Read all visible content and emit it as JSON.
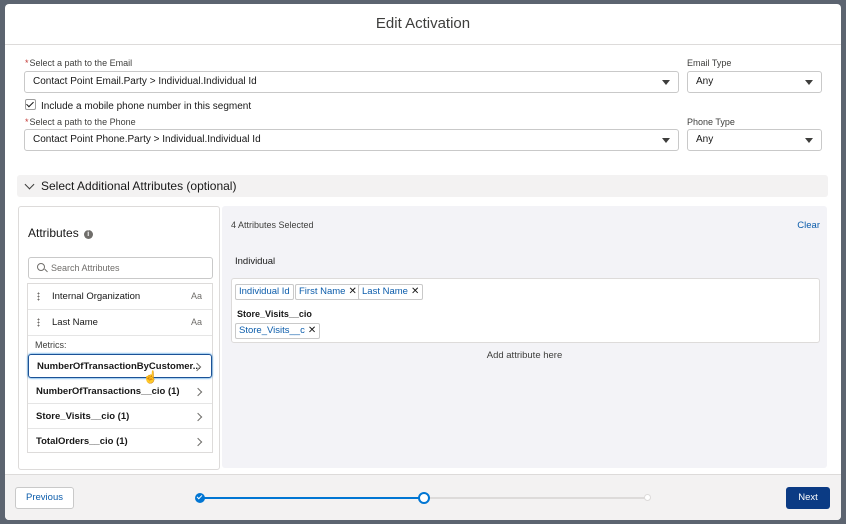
{
  "modal": {
    "title": "Edit Activation"
  },
  "email": {
    "path_label": "Select a path to the Email",
    "path_value": "Contact Point Email.Party > Individual.Individual Id",
    "type_label": "Email Type",
    "type_value": "Any"
  },
  "include_phone": {
    "label": "Include a mobile phone number in this segment",
    "checked": true
  },
  "phone": {
    "path_label": "Select a path to the Phone",
    "path_value": "Contact Point Phone.Party > Individual.Individual Id",
    "type_label": "Phone Type",
    "type_value": "Any"
  },
  "additional_section": {
    "label": "Select Additional Attributes (optional)"
  },
  "attributes_panel": {
    "title": "Attributes",
    "search_placeholder": "Search Attributes",
    "items": [
      {
        "label": "Internal Organization",
        "type_icon": "Aa"
      },
      {
        "label": "Last Name",
        "type_icon": "Aa"
      }
    ],
    "metrics_label": "Metrics:",
    "metrics": [
      {
        "label": "NumberOfTransactionByCustomer..."
      },
      {
        "label": "NumberOfTransactions__cio (1)"
      },
      {
        "label": "Store_Visits__cio (1)"
      },
      {
        "label": "TotalOrders__cio (1)"
      }
    ]
  },
  "selected_panel": {
    "count_text": "4 Attributes Selected",
    "clear_label": "Clear",
    "group_label": "Individual",
    "pills": [
      {
        "label": "Individual Id",
        "removable": false
      },
      {
        "label": "First Name",
        "removable": true
      },
      {
        "label": "Last Name",
        "removable": true
      }
    ],
    "subgroup_label": "Store_Visits__cio",
    "subgroup_pills": [
      {
        "label": "Store_Visits__c",
        "removable": true
      }
    ],
    "drop_hint": "Add attribute here"
  },
  "footer": {
    "previous_label": "Previous",
    "next_label": "Next",
    "progress": {
      "steps": 3,
      "current_step": 2,
      "completed_fraction": 0.5
    }
  },
  "colors": {
    "brand": "#0176d3",
    "next_button": "#0b3b84",
    "link": "#0b5cab"
  }
}
